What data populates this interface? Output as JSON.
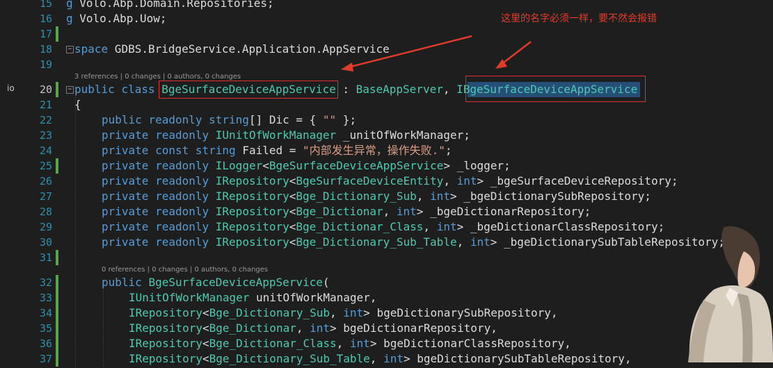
{
  "annotation": {
    "text": "这里的名字必须一样，要不然会报错",
    "color": "#e23b2b"
  },
  "gutter": {
    "visibility_icon": "io",
    "line_numbers": [
      "15",
      "16",
      "17",
      "18",
      "19",
      "20",
      "21",
      "22",
      "23",
      "24",
      "25",
      "26",
      "27",
      "28",
      "29",
      "30",
      "31",
      "32",
      "33",
      "34",
      "35",
      "36",
      "37"
    ]
  },
  "codelens": {
    "class_info": "3 references | 0 changes | 0 authors, 0 changes",
    "ctor_info": "0 references | 0 changes | 0 authors, 0 changes"
  },
  "code": {
    "l15": {
      "kw": "g",
      "rest": " Volo.Abp.Domain.Repositories;"
    },
    "l16": {
      "kw": "g",
      "rest": " Volo.Abp.Uow;"
    },
    "l18": {
      "kw": "space",
      "rest": " GDBS.BridgeService.Application.AppService"
    },
    "l20": {
      "kw1": "public",
      "kw2": "class",
      "class_name": "BgeSurfaceDeviceAppService",
      "colon": " : ",
      "base": "BaseAppServer",
      "comma": ", ",
      "iface": "IBgeSurfaceDeviceAppService"
    },
    "l21": "{",
    "l22": {
      "kw1": "public",
      "kw2": "readonly",
      "kw3": "string",
      "rest": "[] Dic = { ",
      "str": "\"\"",
      "end": " };"
    },
    "l23": {
      "kw1": "private",
      "kw2": "readonly",
      "type": "IUnitOfWorkManager",
      "rest": " _unitOfWorkManager;"
    },
    "l24": {
      "kw1": "private",
      "kw2": "const",
      "kw3": "string",
      "rest": " Failed = ",
      "str": "\"内部发生异常，操作失败.\"",
      "end": ";"
    },
    "l25": {
      "kw1": "private",
      "kw2": "readonly",
      "type": "ILogger",
      "lt": "<",
      "arg": "BgeSurfaceDeviceAppService",
      "rest": "> _logger;"
    },
    "l26": {
      "kw1": "private",
      "kw2": "readonly",
      "type": "IRepository",
      "lt": "<",
      "arg": "BgeSurfaceDeviceEntity",
      "c": ", ",
      "int": "int",
      "rest": "> _bgeSurfaceDeviceRepository;"
    },
    "l27": {
      "kw1": "private",
      "kw2": "readonly",
      "type": "IRepository",
      "lt": "<",
      "arg": "Bge_Dictionary_Sub",
      "c": ", ",
      "int": "int",
      "rest": "> _bgeDictionarySubRepository;"
    },
    "l28": {
      "kw1": "private",
      "kw2": "readonly",
      "type": "IRepository",
      "lt": "<",
      "arg": "Bge_Dictionar",
      "c": ", ",
      "int": "int",
      "rest": "> _bgeDictionarRepository;"
    },
    "l29": {
      "kw1": "private",
      "kw2": "readonly",
      "type": "IRepository",
      "lt": "<",
      "arg": "Bge_Dictionar_Class",
      "c": ", ",
      "int": "int",
      "rest": "> _bgeDictionarClassRepository;"
    },
    "l30": {
      "kw1": "private",
      "kw2": "readonly",
      "type": "IRepository",
      "lt": "<",
      "arg": "Bge_Dictionary_Sub_Table",
      "c": ", ",
      "int": "int",
      "rest": "> _bgeDictionarySubTableRepository;"
    },
    "l32": {
      "kw1": "public",
      "type": "BgeSurfaceDeviceAppService",
      "rest": "("
    },
    "l33": {
      "type": "IUnitOfWorkManager",
      "rest": " unitOfWorkManager,"
    },
    "l34": {
      "type": "IRepository",
      "lt": "<",
      "arg": "Bge_Dictionary_Sub",
      "c": ", ",
      "int": "int",
      "rest": "> bgeDictionarySubRepository,"
    },
    "l35": {
      "type": "IRepository",
      "lt": "<",
      "arg": "Bge_Dictionar",
      "c": ", ",
      "int": "int",
      "rest": "> bgeDictionarRepository,"
    },
    "l36": {
      "type": "IRepository",
      "lt": "<",
      "arg": "Bge_Dictionar_Class",
      "c": ", ",
      "int": "int",
      "rest": "> bgeDictionarClassRepository,"
    },
    "l37": {
      "type": "IRepository",
      "lt": "<",
      "arg": "Bge_Dictionary_Sub_Table",
      "c": ", ",
      "int": "int",
      "rest": "> bgeDictionarySubTableRepository,"
    }
  }
}
